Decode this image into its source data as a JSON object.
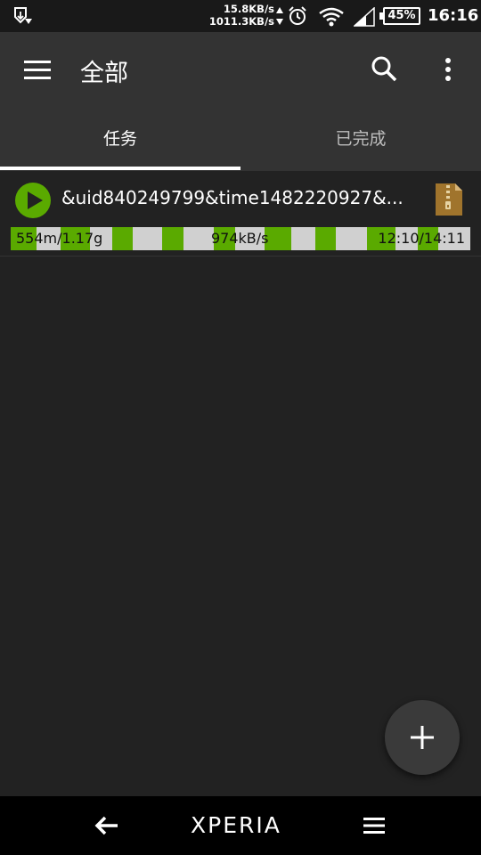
{
  "status_bar": {
    "upload_speed": "15.8KB/s",
    "download_speed": "1011.3KB/s",
    "battery": "45%",
    "time": "16:16",
    "icons": [
      "download-notification-icon",
      "alarm-icon",
      "wifi-icon",
      "signal-icon",
      "battery-icon"
    ]
  },
  "app_bar": {
    "title": "全部",
    "icons": [
      "menu-icon",
      "search-icon",
      "more-vert-icon"
    ]
  },
  "tabs": [
    {
      "label": "任务",
      "active": true
    },
    {
      "label": "已完成",
      "active": false
    }
  ],
  "tasks": [
    {
      "name": "&uid840249799&time1482220927&...",
      "downloaded": "554m/1.17g",
      "speed": "974kB/s",
      "time": "12:10/14:11",
      "file_icon": "zip-file-icon",
      "action_icon": "play-icon"
    }
  ],
  "fab": {
    "icon": "add-icon"
  },
  "nav_bar": {
    "brand": "XPERIA",
    "icons": [
      "back-icon",
      "menu-icon"
    ]
  },
  "colors": {
    "background": "#222222",
    "app_bar": "#333333",
    "accent_green": "#5aaa00",
    "progress_bg": "#d0d0d0"
  }
}
